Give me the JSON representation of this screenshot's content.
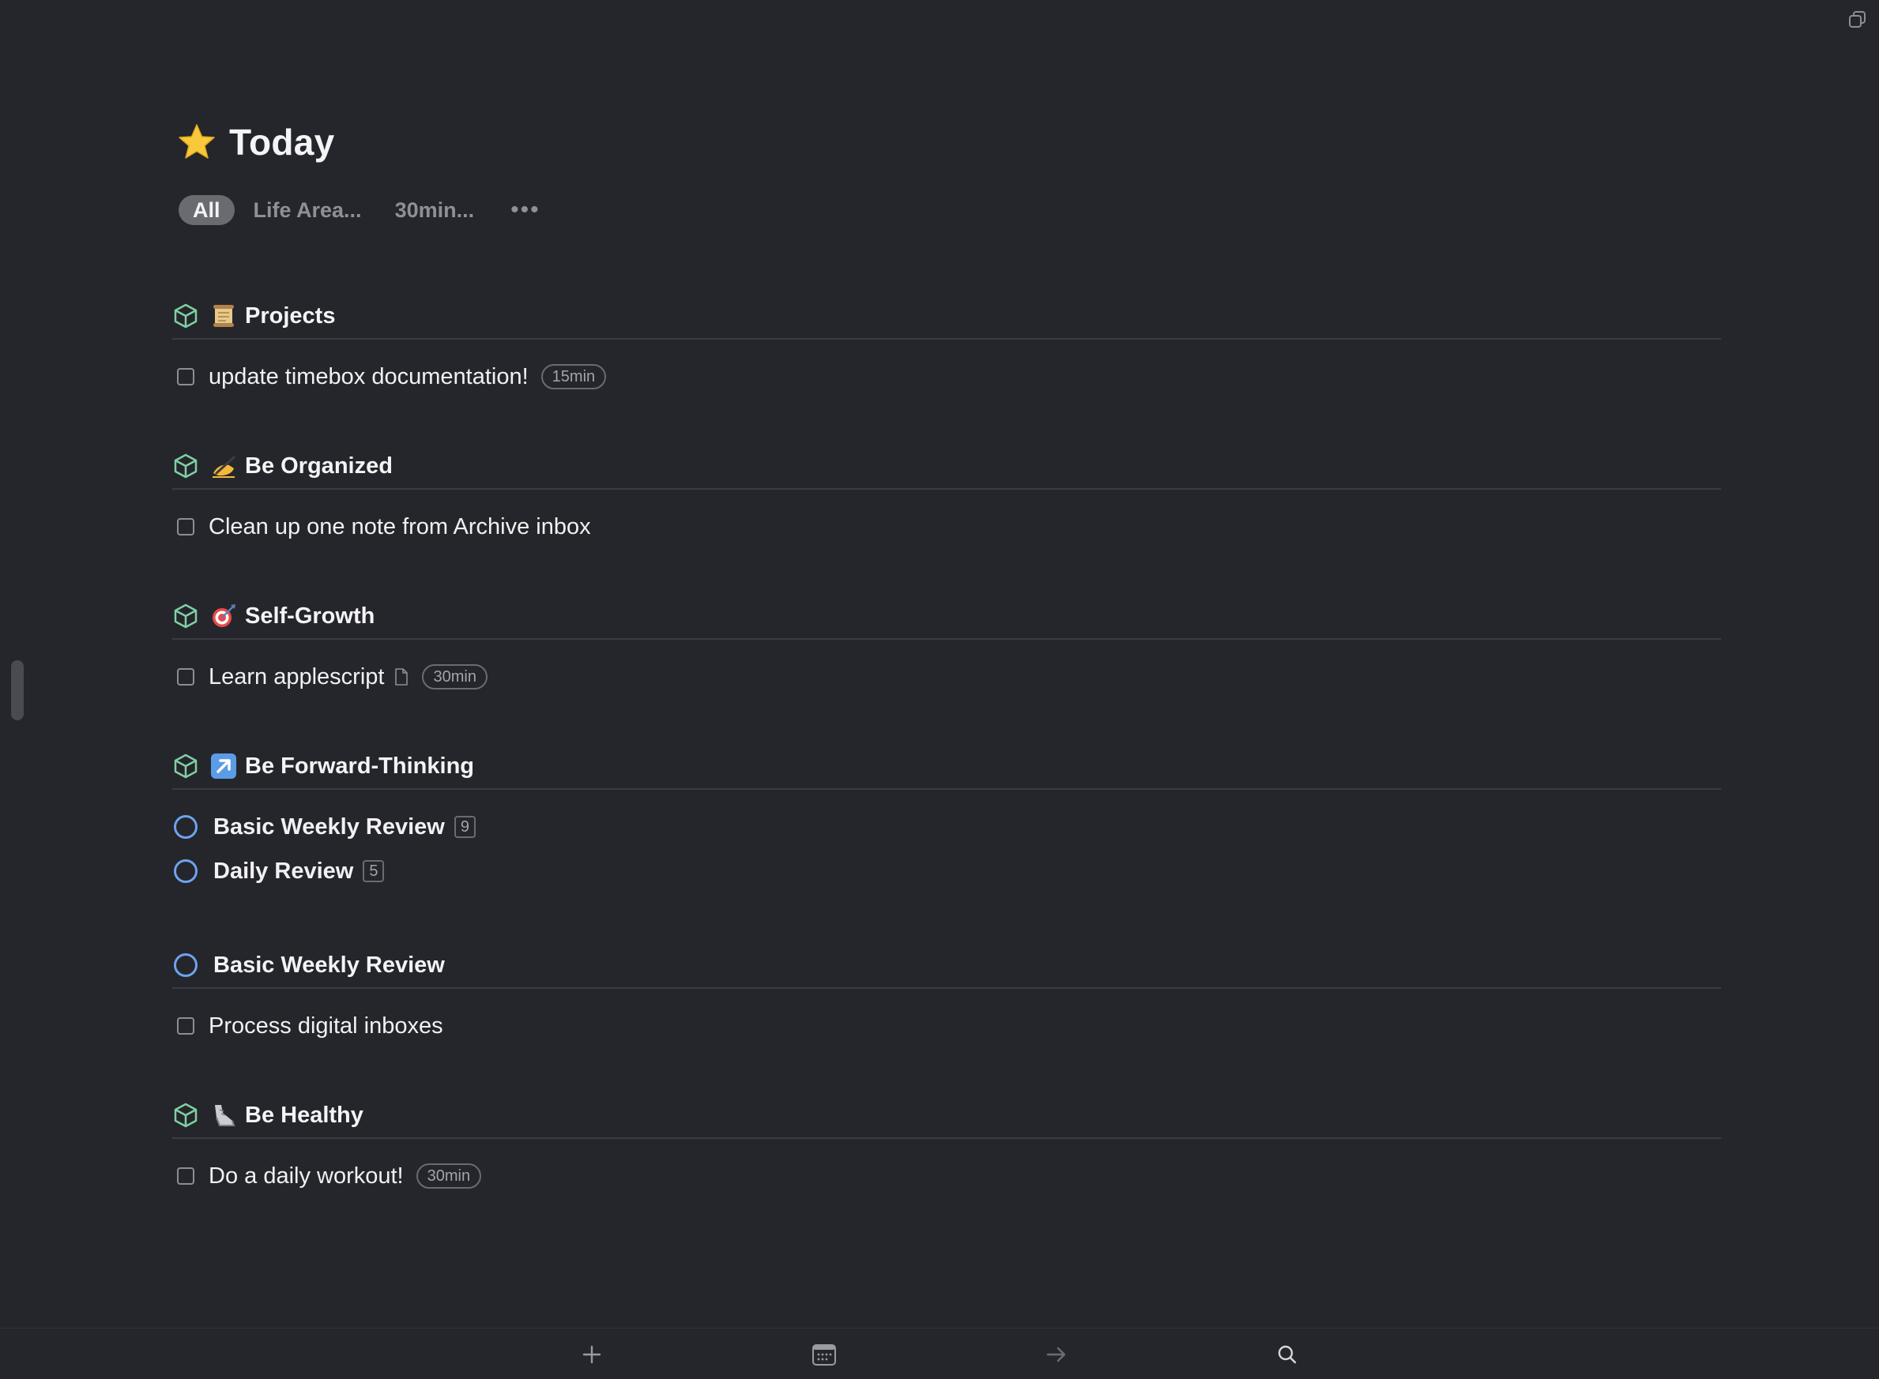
{
  "page": {
    "title": "Today",
    "title_icon": "star-icon"
  },
  "filters": {
    "items": [
      {
        "label": "All",
        "active": true
      },
      {
        "label": "Life Area..."
      },
      {
        "label": "30min..."
      }
    ],
    "more": "•••"
  },
  "groups": [
    {
      "title": "Projects",
      "icon": "scroll-icon",
      "kind": "area",
      "items": [
        {
          "text": "update timebox documentation!",
          "duration": "15min"
        }
      ]
    },
    {
      "title": "Be Organized",
      "icon": "writing-hand-icon",
      "kind": "area",
      "items": [
        {
          "text": "Clean up one note from Archive inbox"
        }
      ]
    },
    {
      "title": "Self-Growth",
      "icon": "target-icon",
      "kind": "area",
      "items": [
        {
          "text": "Learn applescript",
          "has_note": true,
          "duration": "30min"
        }
      ]
    },
    {
      "title": "Be Forward-Thinking",
      "icon": "arrow-up-right-icon",
      "kind": "area",
      "items": [
        {
          "text": "Basic Weekly Review",
          "type": "project",
          "count": "9"
        },
        {
          "text": "Daily Review",
          "type": "project",
          "count": "5"
        }
      ]
    },
    {
      "title": "Basic Weekly Review",
      "kind": "project",
      "items": [
        {
          "text": "Process digital inboxes"
        }
      ]
    },
    {
      "title": "Be Healthy",
      "icon": "sneaker-icon",
      "kind": "area",
      "items": [
        {
          "text": "Do a daily workout!",
          "duration": "30min"
        }
      ]
    }
  ],
  "toolbar": {
    "buttons": [
      "plus-icon",
      "calendar-icon",
      "arrow-right-icon",
      "search-icon"
    ]
  },
  "colors": {
    "background": "#25262b",
    "area_icon": "#7fd0a4",
    "project_circle": "#6fa2f0",
    "divider": "#3b3c41"
  }
}
